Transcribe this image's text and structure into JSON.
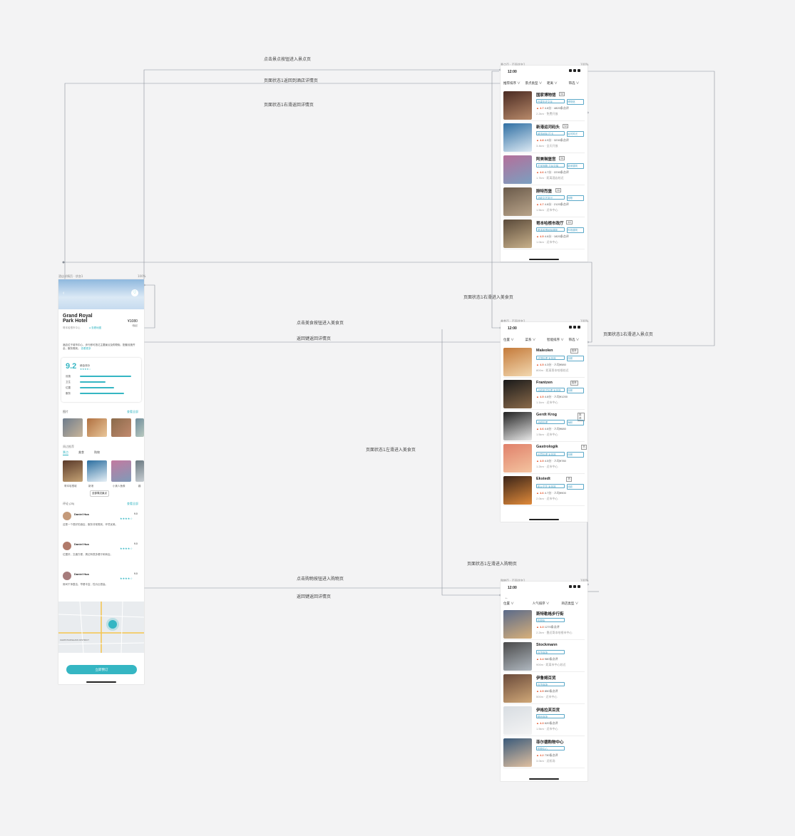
{
  "connectors": {
    "c1": "点击景点按钮进入景点页",
    "c2": "页面状态1返回到酒店详情页",
    "c3": "页面状态1右滑返回详情页",
    "c4": "点击美食按钮进入美食页",
    "c5": "返回键返回详情页",
    "c6": "页面状态1右滑进入美食页",
    "c7": "页面状态1右滑进入景点页",
    "c8": "页面状态1左滑进入美食页",
    "c9": "页面状态1左滑进入购物页",
    "c10": "点击购物按钮进入购物页",
    "c11": "返回键返回详情页"
  },
  "detail": {
    "top_caption": "酒店详情页 · 状态1",
    "top_right": "100%",
    "hotel_name_line1": "Grand Royal",
    "hotel_name_line2": "Park Hotel",
    "price": "¥1080",
    "price_sub": "/晚起",
    "address": "哥本哈根市中心",
    "location_tag": "查看地图",
    "description": "酒店位于城市中心，步行即可抵达主要景点及购物街。配套设施齐全，服务周到。",
    "more_link": "查看更多",
    "score": "9.2",
    "score_label": "综合评分",
    "rating_rows": [
      "设施",
      "卫生",
      "位置",
      "服务"
    ],
    "rating_fills": [
      0.9,
      0.45,
      0.6,
      0.78
    ],
    "photos_label": "图片",
    "photos_more": "查看全部",
    "nearby_label": "周边推荐",
    "nearby_tabs": [
      "景点",
      "美食",
      "购物"
    ],
    "nearby_captions": [
      "哥本哈根城",
      "新港",
      "小美人鱼像",
      "趣"
    ],
    "nearby_button": "全部周边景点",
    "reviews_label": "评论 (25)",
    "reviews_more": "查看全部",
    "reviews": [
      {
        "name": "Daniel Hua",
        "score": "9.0",
        "stars": "★★★★☆",
        "text": "这是一个很好的酒店，服务非常周到，环境优美。"
      },
      {
        "name": "Daniel Hua",
        "score": "9.0",
        "stars": "★★★★☆",
        "text": "位置好，交通方便，周边有很多餐厅和商店。"
      },
      {
        "name": "Daniel Hua",
        "score": "9.0",
        "stars": "★★★★☆",
        "text": "房间干净整洁，早餐丰富，性价比很高。"
      }
    ],
    "map_label": "CHRISTIANSHAVN DISTRICT",
    "book_button": "立即预订"
  },
  "attractions": {
    "top_caption": "景点页 · 页面状态1",
    "top_right": "100%",
    "time": "12:00",
    "filters": [
      "推荐排序 ∨",
      "景点类型 ∨",
      "距离 ∨",
      "筛选 ∨"
    ],
    "items": [
      {
        "name": "国家博物馆",
        "badge": "5A",
        "tag": "丹麦历史文化",
        "tag2": "博物馆",
        "score": "4.7",
        "meta": "4.8分 · 4820条点评",
        "meta2": "2.2km · 免费开放"
      },
      {
        "name": "新港运河码头",
        "badge": "5A",
        "tag": "城市地标·打卡",
        "tag2": "运河风光",
        "score": "4.8",
        "meta": "4.9分 · 3230条点评",
        "meta2": "3.4km · 全天开放"
      },
      {
        "name": "阿美琳堡宫",
        "badge": "5A",
        "tag": "王室宫殿·卫兵交接",
        "tag2": "皇家建筑",
        "score": "4.6",
        "meta": "4.7分 · 2230条点评",
        "meta2": "1.7km · 距离酒店较近"
      },
      {
        "name": "腓特烈堡",
        "badge": "4A",
        "tag": "北欧文艺复兴",
        "tag2": "宫殿",
        "score": "4.7",
        "meta": "4.8分 · 2120条点评",
        "meta2": "1.5km · 近市中心"
      },
      {
        "name": "哥本哈根市政厅",
        "badge": "4A",
        "tag": "哥本哈根地标建筑",
        "tag2": "市政建筑",
        "score": "4.5",
        "meta": "4.6分 · 1820条点评",
        "meta2": "1.0km · 近市中心"
      }
    ]
  },
  "food": {
    "top_caption": "美食页 · 页面状态1",
    "top_right": "100%",
    "time": "12:00",
    "filters": [
      "位置 ∨",
      "菜系 ∨",
      "智能排序 ∨",
      "筛选 ∨"
    ],
    "items": [
      {
        "name": "Maleolen",
        "badge": "推荐",
        "tag": "法国料理·米其林",
        "tag2": "西餐",
        "score": "4.5",
        "meta": "4.3分 · 人均¥580",
        "meta2": "800m · 距离哥本哈根较近"
      },
      {
        "name": "Frantzen",
        "badge": "推荐",
        "tag": "北欧新式料理·米其林",
        "tag2": "西餐",
        "score": "4.5",
        "meta": "4.8分 · 人均¥1200",
        "meta2": "1.1km · 近市中心"
      },
      {
        "name": "Gerdt Krog",
        "badge": "推荐",
        "tag": "北欧料理",
        "tag2": "海鲜",
        "score": "4.6",
        "meta": "4.6分 · 人均¥680",
        "meta2": "1.5km · 近市中心"
      },
      {
        "name": "Gastrologik",
        "badge": "热",
        "tag": "创意料理·米其林",
        "tag2": "西餐",
        "score": "4.5",
        "meta": "4.5分 · 人均¥780",
        "meta2": "1.2km · 近市中心"
      },
      {
        "name": "Ekstedt",
        "badge": "热",
        "tag": "明火烹饪·米其林",
        "tag2": "北欧",
        "score": "4.6",
        "meta": "4.7分 · 人均¥900",
        "meta2": "2.0km · 近市中心"
      }
    ]
  },
  "shopping": {
    "top_caption": "购物页 · 页面状态1",
    "top_right": "100%",
    "time": "12:00",
    "filters": [
      "位置 ∨",
      "人气排序 ∨",
      "商店类型 ∨"
    ],
    "items": [
      {
        "name": "斯特勒格步行街",
        "tag": "购物街",
        "score": "4.3",
        "meta": "1270条点评",
        "meta2": "2.2km · 靠近哥本哈根市中心"
      },
      {
        "name": "Stockmann",
        "tag": "百货商场",
        "score": "4.4",
        "meta": "980条点评",
        "meta2": "900m · 距离市中心较近"
      },
      {
        "name": "伊鲁姆百货",
        "tag": "百货商场",
        "score": "4.5",
        "meta": "850条点评",
        "meta2": "500m · 近市中心"
      },
      {
        "name": "伊格拉芙百货",
        "tag": "精品商场",
        "score": "4.3",
        "meta": "620条点评",
        "meta2": "1.5km · 近市中心"
      },
      {
        "name": "菲尔德购物中心",
        "tag": "购物中心",
        "score": "4.2",
        "meta": "730条点评",
        "meta2": "3.0km · 近机场"
      }
    ]
  }
}
